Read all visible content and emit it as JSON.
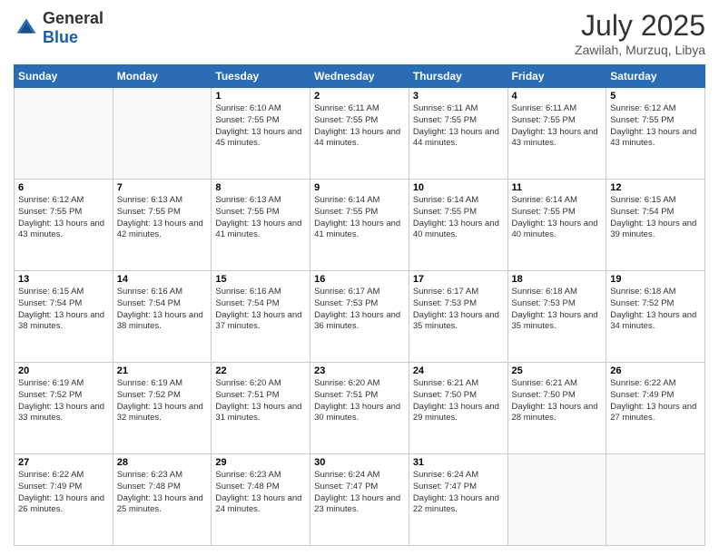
{
  "logo": {
    "general": "General",
    "blue": "Blue"
  },
  "header": {
    "month_year": "July 2025",
    "location": "Zawilah, Murzuq, Libya"
  },
  "weekdays": [
    "Sunday",
    "Monday",
    "Tuesday",
    "Wednesday",
    "Thursday",
    "Friday",
    "Saturday"
  ],
  "weeks": [
    [
      {
        "day": "",
        "info": ""
      },
      {
        "day": "",
        "info": ""
      },
      {
        "day": "1",
        "info": "Sunrise: 6:10 AM\nSunset: 7:55 PM\nDaylight: 13 hours and 45 minutes."
      },
      {
        "day": "2",
        "info": "Sunrise: 6:11 AM\nSunset: 7:55 PM\nDaylight: 13 hours and 44 minutes."
      },
      {
        "day": "3",
        "info": "Sunrise: 6:11 AM\nSunset: 7:55 PM\nDaylight: 13 hours and 44 minutes."
      },
      {
        "day": "4",
        "info": "Sunrise: 6:11 AM\nSunset: 7:55 PM\nDaylight: 13 hours and 43 minutes."
      },
      {
        "day": "5",
        "info": "Sunrise: 6:12 AM\nSunset: 7:55 PM\nDaylight: 13 hours and 43 minutes."
      }
    ],
    [
      {
        "day": "6",
        "info": "Sunrise: 6:12 AM\nSunset: 7:55 PM\nDaylight: 13 hours and 43 minutes."
      },
      {
        "day": "7",
        "info": "Sunrise: 6:13 AM\nSunset: 7:55 PM\nDaylight: 13 hours and 42 minutes."
      },
      {
        "day": "8",
        "info": "Sunrise: 6:13 AM\nSunset: 7:55 PM\nDaylight: 13 hours and 41 minutes."
      },
      {
        "day": "9",
        "info": "Sunrise: 6:14 AM\nSunset: 7:55 PM\nDaylight: 13 hours and 41 minutes."
      },
      {
        "day": "10",
        "info": "Sunrise: 6:14 AM\nSunset: 7:55 PM\nDaylight: 13 hours and 40 minutes."
      },
      {
        "day": "11",
        "info": "Sunrise: 6:14 AM\nSunset: 7:55 PM\nDaylight: 13 hours and 40 minutes."
      },
      {
        "day": "12",
        "info": "Sunrise: 6:15 AM\nSunset: 7:54 PM\nDaylight: 13 hours and 39 minutes."
      }
    ],
    [
      {
        "day": "13",
        "info": "Sunrise: 6:15 AM\nSunset: 7:54 PM\nDaylight: 13 hours and 38 minutes."
      },
      {
        "day": "14",
        "info": "Sunrise: 6:16 AM\nSunset: 7:54 PM\nDaylight: 13 hours and 38 minutes."
      },
      {
        "day": "15",
        "info": "Sunrise: 6:16 AM\nSunset: 7:54 PM\nDaylight: 13 hours and 37 minutes."
      },
      {
        "day": "16",
        "info": "Sunrise: 6:17 AM\nSunset: 7:53 PM\nDaylight: 13 hours and 36 minutes."
      },
      {
        "day": "17",
        "info": "Sunrise: 6:17 AM\nSunset: 7:53 PM\nDaylight: 13 hours and 35 minutes."
      },
      {
        "day": "18",
        "info": "Sunrise: 6:18 AM\nSunset: 7:53 PM\nDaylight: 13 hours and 35 minutes."
      },
      {
        "day": "19",
        "info": "Sunrise: 6:18 AM\nSunset: 7:52 PM\nDaylight: 13 hours and 34 minutes."
      }
    ],
    [
      {
        "day": "20",
        "info": "Sunrise: 6:19 AM\nSunset: 7:52 PM\nDaylight: 13 hours and 33 minutes."
      },
      {
        "day": "21",
        "info": "Sunrise: 6:19 AM\nSunset: 7:52 PM\nDaylight: 13 hours and 32 minutes."
      },
      {
        "day": "22",
        "info": "Sunrise: 6:20 AM\nSunset: 7:51 PM\nDaylight: 13 hours and 31 minutes."
      },
      {
        "day": "23",
        "info": "Sunrise: 6:20 AM\nSunset: 7:51 PM\nDaylight: 13 hours and 30 minutes."
      },
      {
        "day": "24",
        "info": "Sunrise: 6:21 AM\nSunset: 7:50 PM\nDaylight: 13 hours and 29 minutes."
      },
      {
        "day": "25",
        "info": "Sunrise: 6:21 AM\nSunset: 7:50 PM\nDaylight: 13 hours and 28 minutes."
      },
      {
        "day": "26",
        "info": "Sunrise: 6:22 AM\nSunset: 7:49 PM\nDaylight: 13 hours and 27 minutes."
      }
    ],
    [
      {
        "day": "27",
        "info": "Sunrise: 6:22 AM\nSunset: 7:49 PM\nDaylight: 13 hours and 26 minutes."
      },
      {
        "day": "28",
        "info": "Sunrise: 6:23 AM\nSunset: 7:48 PM\nDaylight: 13 hours and 25 minutes."
      },
      {
        "day": "29",
        "info": "Sunrise: 6:23 AM\nSunset: 7:48 PM\nDaylight: 13 hours and 24 minutes."
      },
      {
        "day": "30",
        "info": "Sunrise: 6:24 AM\nSunset: 7:47 PM\nDaylight: 13 hours and 23 minutes."
      },
      {
        "day": "31",
        "info": "Sunrise: 6:24 AM\nSunset: 7:47 PM\nDaylight: 13 hours and 22 minutes."
      },
      {
        "day": "",
        "info": ""
      },
      {
        "day": "",
        "info": ""
      }
    ]
  ]
}
